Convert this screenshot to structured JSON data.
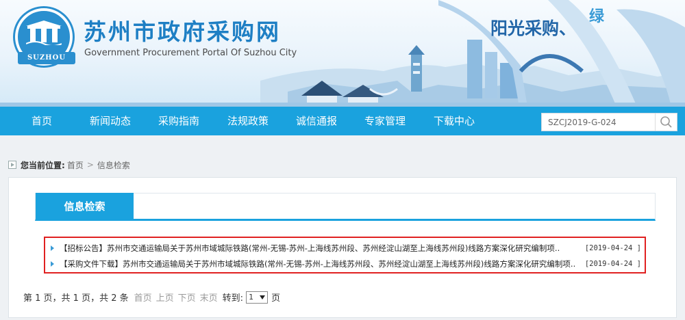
{
  "header": {
    "title": "苏州市政府采购网",
    "subtitle": "Government Procurement Portal Of Suzhou City",
    "logo_text": "SUZHOU",
    "slogan": "阳光采购、",
    "slogan_tail": "绿"
  },
  "nav": {
    "items": [
      "首页",
      "新闻动态",
      "采购指南",
      "法规政策",
      "诚信通报",
      "专家管理",
      "下载中心"
    ]
  },
  "search": {
    "value": "SZCJ2019-G-024"
  },
  "breadcrumb": {
    "label": "您当前位置:",
    "home": "首页",
    "separator": ">",
    "current": "信息检索"
  },
  "panel": {
    "tab": "信息检索"
  },
  "results": [
    {
      "category": "【招标公告】",
      "title": "苏州市交通运输局关于苏州市域城际铁路(常州-无锡-苏州-上海线苏州段、苏州经淀山湖至上海线苏州段)线路方案深化研究编制项..",
      "date": "[2019-04-24 ]"
    },
    {
      "category": "【采购文件下载】",
      "title": "苏州市交通运输局关于苏州市域城际铁路(常州-无锡-苏州-上海线苏州段、苏州经淀山湖至上海线苏州段)线路方案深化研究编制项..",
      "date": "[2019-04-24 ]"
    }
  ],
  "pager": {
    "summary": "第 1 页，共 1 页，共 2 条",
    "first": "首页",
    "prev": "上页",
    "next": "下页",
    "last": "末页",
    "goto_label": "转到:",
    "page_value": "1",
    "page_suffix": "页"
  },
  "colors": {
    "nav_bg": "#1aa2de",
    "title_blue": "#1e7fc4",
    "highlight_border": "#e02020"
  }
}
